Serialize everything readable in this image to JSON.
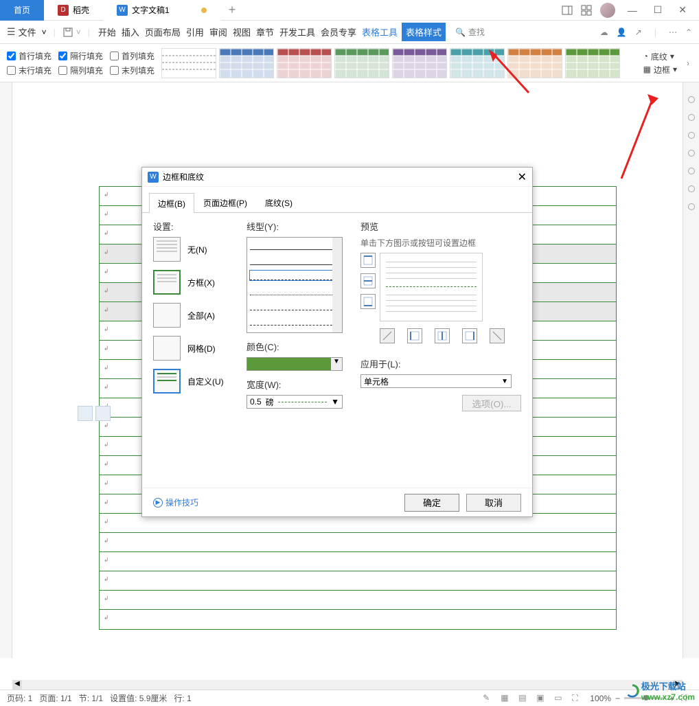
{
  "tabs": {
    "home": "首页",
    "docell_name": "稻壳",
    "doc_name": "文字文稿1"
  },
  "menu": {
    "file_label": "文件",
    "items": [
      "开始",
      "插入",
      "页面布局",
      "引用",
      "审阅",
      "视图",
      "章节",
      "开发工具",
      "会员专享",
      "表格工具",
      "表格样式"
    ],
    "search_placeholder": "查找"
  },
  "ribbon_checks": {
    "first_row_fill": "首行填充",
    "alt_row_fill": "隔行填充",
    "first_col_fill": "首列填充",
    "last_row_fill": "末行填充",
    "alt_col_fill": "隔列填充",
    "last_col_fill": "末列填充"
  },
  "ribbon_right": {
    "shading": "底纹",
    "border": "边框"
  },
  "dialog": {
    "title": "边框和底纹",
    "tabs": [
      "边框(B)",
      "页面边框(P)",
      "底纹(S)"
    ],
    "settings_label": "设置:",
    "settings": {
      "none": "无(N)",
      "box": "方框(X)",
      "all": "全部(A)",
      "grid": "网格(D)",
      "custom": "自定义(U)"
    },
    "line_style_label": "线型(Y):",
    "color_label": "颜色(C):",
    "width_label": "宽度(W):",
    "width_value": "0.5",
    "width_unit": "磅",
    "preview_label": "预览",
    "preview_hint": "单击下方图示或按钮可设置边框",
    "apply_label": "应用于(L):",
    "apply_value": "单元格",
    "options_btn": "选项(O)...",
    "tip_link": "操作技巧",
    "ok": "确定",
    "cancel": "取消"
  },
  "status": {
    "page_label": "页码: 1",
    "page_count": "页面: 1/1",
    "section": "节: 1/1",
    "set_value": "设置值: 5.9厘米",
    "row": "行: 1",
    "zoom": "100%"
  },
  "watermark": {
    "brand": "极光下载站",
    "url": "www.xz7.com"
  },
  "style_colors": [
    "#888888",
    "#4a7ab8",
    "#b85050",
    "#5a9a5a",
    "#7a5a9a",
    "#4aa0a8",
    "#d08040",
    "#5a9a3a"
  ]
}
